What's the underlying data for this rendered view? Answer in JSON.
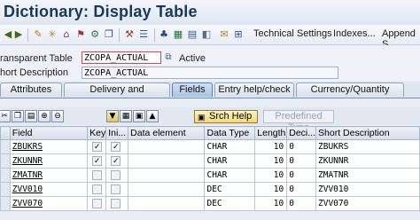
{
  "window": {
    "title": "Dictionary: Display Table"
  },
  "toolbar": {
    "technical_settings": "Technical Settings",
    "indexes": "Indexes...",
    "append": "Append S"
  },
  "header": {
    "transparent_table_label": "ransparent Table",
    "table_name": "ZCOPA_ACTUAL",
    "status": "Active",
    "short_description_label": "hort Description",
    "short_description": "ZCOPA_ACTUAL"
  },
  "tabs": [
    {
      "label": "Attributes",
      "active": false
    },
    {
      "label": "Delivery and Maintenance",
      "active": false
    },
    {
      "label": "Fields",
      "active": true
    },
    {
      "label": "Entry help/check",
      "active": false
    },
    {
      "label": "Currency/Quantity Fields",
      "active": false
    }
  ],
  "table_toolbar": {
    "srch_help": "Srch Help",
    "predefined_type": "Predefined Type"
  },
  "columns": {
    "field": "Field",
    "key": "Key",
    "initial": "Ini...",
    "data_element": "Data element",
    "data_type": "Data Type",
    "length": "Length",
    "decimals": "Deci...",
    "short_description": "Short Description"
  },
  "rows": [
    {
      "field": "ZBUKRS",
      "key": true,
      "initial": true,
      "data_element": "",
      "data_type": "CHAR",
      "length": "10",
      "decimals": "0",
      "short_description": "ZBUKRS"
    },
    {
      "field": "ZKUNNR",
      "key": true,
      "initial": true,
      "data_element": "",
      "data_type": "CHAR",
      "length": "10",
      "decimals": "0",
      "short_description": "ZKUNNR"
    },
    {
      "field": "ZMATNR",
      "key": false,
      "initial": false,
      "data_element": "",
      "data_type": "CHAR",
      "length": "10",
      "decimals": "0",
      "short_description": "ZMATNR"
    },
    {
      "field": "ZVV010",
      "key": false,
      "initial": false,
      "data_element": "",
      "data_type": "DEC",
      "length": "10",
      "decimals": "0",
      "short_description": "ZVV010"
    },
    {
      "field": "ZVV070",
      "key": false,
      "initial": false,
      "data_element": "",
      "data_type": "DEC",
      "length": "10",
      "decimals": "0",
      "short_description": "ZVV070"
    }
  ],
  "colors": {
    "title": "#17375e",
    "active_tab": "#a9c3e6",
    "srch_help": "#f2d77a"
  }
}
